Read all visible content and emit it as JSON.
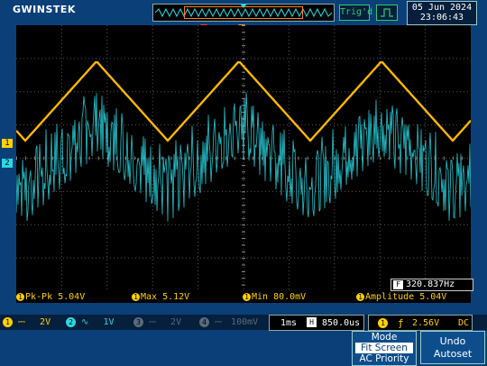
{
  "brand": "GWINSTEK",
  "trigger_status": "Trig'd",
  "datetime": {
    "date": "05 Jun 2024",
    "time": "23:06:43"
  },
  "frequency": {
    "label": "F",
    "value": "320.837Hz"
  },
  "measurements": [
    {
      "ch": "1",
      "label": "Pk-Pk 5.04V"
    },
    {
      "ch": "1",
      "label": "Max 5.12V"
    },
    {
      "ch": "1",
      "label": "Min 80.0mV"
    },
    {
      "ch": "1",
      "label": "Amplitude 5.04V"
    }
  ],
  "channels": [
    {
      "id": "1",
      "coupling": "DC",
      "scale": "2V",
      "color": "#ffd200"
    },
    {
      "id": "2",
      "coupling": "AC",
      "scale": "1V",
      "color": "#29d9e6"
    },
    {
      "id": "3",
      "scale": "2V",
      "color": "#5a6b7c"
    },
    {
      "id": "4",
      "scale": "100mV",
      "color": "#5a6b7c"
    }
  ],
  "timebase": {
    "scale": "1ms",
    "position_label": "H",
    "position": "850.0us"
  },
  "trigger": {
    "source": "1",
    "slope": "rising",
    "level": "2.56V",
    "coupling": "DC"
  },
  "menu": {
    "mode_title": "Mode",
    "mode_selected": "Fit Screen",
    "mode_other": "AC Priority",
    "undo_line1": "Undo",
    "undo_line2": "Autoset"
  },
  "colors": {
    "ch1": "#ffd200",
    "ch2": "#29d9e6",
    "accent_green": "#2ecc71",
    "panel": "#0a3f78"
  }
}
